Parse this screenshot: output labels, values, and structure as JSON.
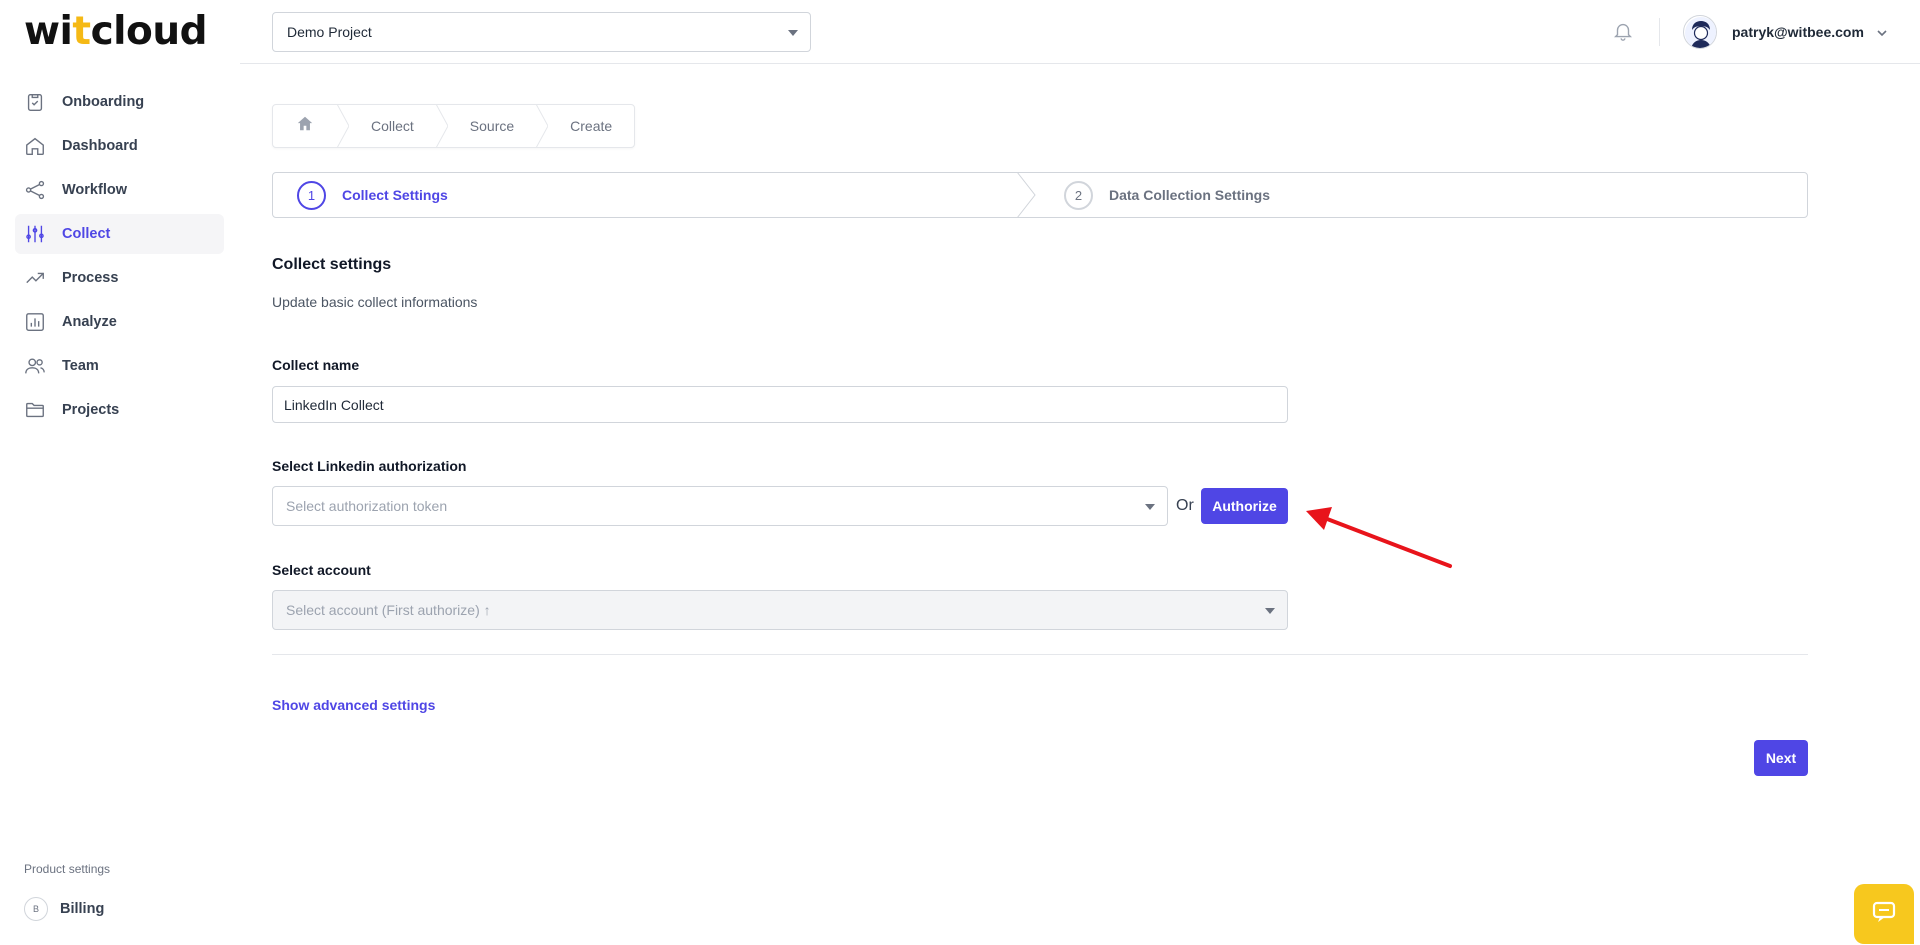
{
  "app": {
    "logo_prefix": "wi",
    "logo_accent": "t",
    "logo_suffix": "cloud",
    "accent_color": "#4f46e5",
    "brand_yellow": "#f5b915"
  },
  "sidebar": {
    "items": [
      {
        "label": "Onboarding",
        "icon": "clipboard-icon",
        "active": false
      },
      {
        "label": "Dashboard",
        "icon": "home-icon",
        "active": false
      },
      {
        "label": "Workflow",
        "icon": "share-nodes-icon",
        "active": false
      },
      {
        "label": "Collect",
        "icon": "sliders-icon",
        "active": true
      },
      {
        "label": "Process",
        "icon": "trend-up-icon",
        "active": false
      },
      {
        "label": "Analyze",
        "icon": "bar-chart-icon",
        "active": false
      },
      {
        "label": "Team",
        "icon": "users-icon",
        "active": false
      },
      {
        "label": "Projects",
        "icon": "folder-icon",
        "active": false
      }
    ],
    "product_settings_label": "Product settings",
    "billing_badge": "B",
    "billing_label": "Billing"
  },
  "topbar": {
    "project_value": "Demo Project",
    "user_email": "patryk@witbee.com"
  },
  "breadcrumb": {
    "items": [
      "Collect",
      "Source",
      "Create"
    ]
  },
  "steps": [
    {
      "number": "1",
      "label": "Collect Settings",
      "active": true
    },
    {
      "number": "2",
      "label": "Data Collection Settings",
      "active": false
    }
  ],
  "form": {
    "title": "Collect settings",
    "subtitle": "Update basic collect informations",
    "collect_name_label": "Collect name",
    "collect_name_value": "LinkedIn Collect",
    "auth_label": "Select Linkedin authorization",
    "auth_placeholder": "Select authorization token",
    "or_text": "Or",
    "authorize_button": "Authorize",
    "account_label": "Select account",
    "account_placeholder": "Select account (First authorize) ↑",
    "advanced_link": "Show advanced settings",
    "next_button": "Next"
  },
  "annotation": {
    "arrow_color": "#e8141b"
  }
}
